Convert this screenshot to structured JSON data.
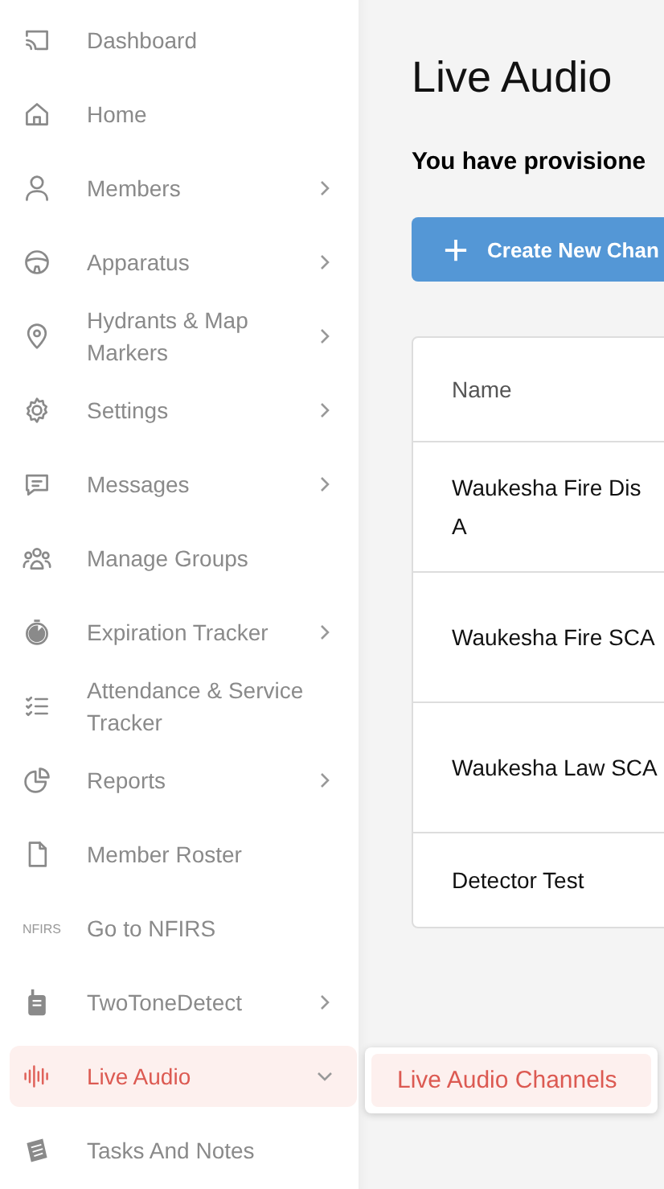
{
  "sidebar": {
    "items": [
      {
        "label": "Dashboard",
        "kind": "link",
        "selected": false
      },
      {
        "label": "Home",
        "kind": "link",
        "selected": false
      },
      {
        "label": "Members",
        "kind": "menu",
        "expanded": false,
        "selected": false
      },
      {
        "label": "Apparatus",
        "kind": "menu",
        "expanded": false,
        "selected": false
      },
      {
        "label": "Hydrants & Map Markers",
        "kind": "menu",
        "expanded": false,
        "selected": false
      },
      {
        "label": "Settings",
        "kind": "menu",
        "expanded": false,
        "selected": false
      },
      {
        "label": "Messages",
        "kind": "menu",
        "expanded": false,
        "selected": false
      },
      {
        "label": "Manage Groups",
        "kind": "link",
        "selected": false
      },
      {
        "label": "Expiration Tracker",
        "kind": "menu",
        "expanded": false,
        "selected": false
      },
      {
        "label": "Attendance & Service Tracker",
        "kind": "link",
        "selected": false
      },
      {
        "label": "Reports",
        "kind": "menu",
        "expanded": false,
        "selected": false
      },
      {
        "label": "Member Roster",
        "kind": "link",
        "selected": false
      },
      {
        "label": "Go to NFIRS",
        "icon_text": "NFIRS",
        "kind": "link",
        "selected": false
      },
      {
        "label": "TwoToneDetect",
        "kind": "menu",
        "expanded": false,
        "selected": false
      },
      {
        "label": "Live Audio",
        "kind": "menu",
        "expanded": true,
        "selected": true
      },
      {
        "label": "Tasks And Notes",
        "kind": "link",
        "selected": false
      }
    ]
  },
  "flyout": {
    "items": [
      {
        "label": "Live Audio Channels",
        "selected": true
      }
    ]
  },
  "page": {
    "title": "Live Audio",
    "notice": "You have provisione",
    "create_button": "Create New Chan"
  },
  "table": {
    "columns": [
      "Name"
    ],
    "rows": [
      {
        "lines": [
          "Waukesha Fire Dis",
          "A"
        ]
      },
      {
        "lines": [
          "Waukesha Fire SCA"
        ]
      },
      {
        "lines": [
          "Waukesha Law SCA"
        ]
      },
      {
        "lines": [
          "Detector Test"
        ]
      }
    ]
  }
}
